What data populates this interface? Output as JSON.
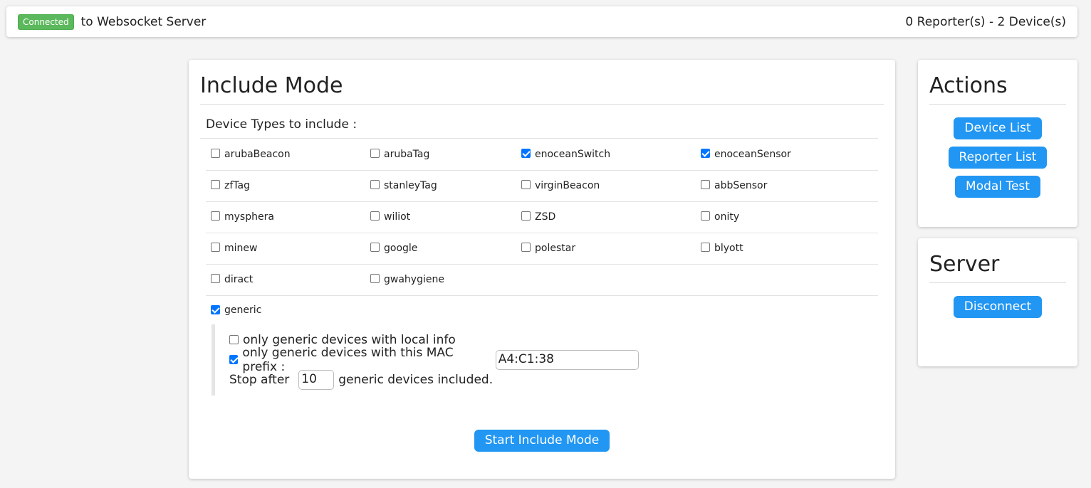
{
  "topbar": {
    "badge": "Connected",
    "status_text": "to Websocket Server",
    "counts": "0 Reporter(s) - 2 Device(s)"
  },
  "include": {
    "title": "Include Mode",
    "subtitle": "Device Types to include :",
    "types": [
      [
        {
          "label": "arubaBeacon",
          "checked": false
        },
        {
          "label": "arubaTag",
          "checked": false
        },
        {
          "label": "enoceanSwitch",
          "checked": true
        },
        {
          "label": "enoceanSensor",
          "checked": true
        }
      ],
      [
        {
          "label": "zfTag",
          "checked": false
        },
        {
          "label": "stanleyTag",
          "checked": false
        },
        {
          "label": "virginBeacon",
          "checked": false
        },
        {
          "label": "abbSensor",
          "checked": false
        }
      ],
      [
        {
          "label": "mysphera",
          "checked": false
        },
        {
          "label": "wiliot",
          "checked": false
        },
        {
          "label": "ZSD",
          "checked": false
        },
        {
          "label": "onity",
          "checked": false
        }
      ],
      [
        {
          "label": "minew",
          "checked": false
        },
        {
          "label": "google",
          "checked": false
        },
        {
          "label": "polestar",
          "checked": false
        },
        {
          "label": "blyott",
          "checked": false
        }
      ],
      [
        {
          "label": "diract",
          "checked": false
        },
        {
          "label": "gwahygiene",
          "checked": false
        }
      ]
    ],
    "generic": {
      "label": "generic",
      "checked": true,
      "local_info_label": "only generic devices with local info",
      "local_info_checked": false,
      "mac_prefix_label": "only generic devices with this MAC prefix :",
      "mac_prefix_checked": true,
      "mac_prefix_value": "A4:C1:38",
      "stop_after_label": "Stop after",
      "stop_after_value": "10",
      "stop_after_suffix": "generic devices included."
    },
    "start_button": "Start Include Mode"
  },
  "actions": {
    "title": "Actions",
    "buttons": [
      "Device List",
      "Reporter List",
      "Modal Test"
    ]
  },
  "server": {
    "title": "Server",
    "button": "Disconnect"
  },
  "colors": {
    "badge": "#5cb85c",
    "button": "#2196f3",
    "checkbox": "#0075ff"
  }
}
